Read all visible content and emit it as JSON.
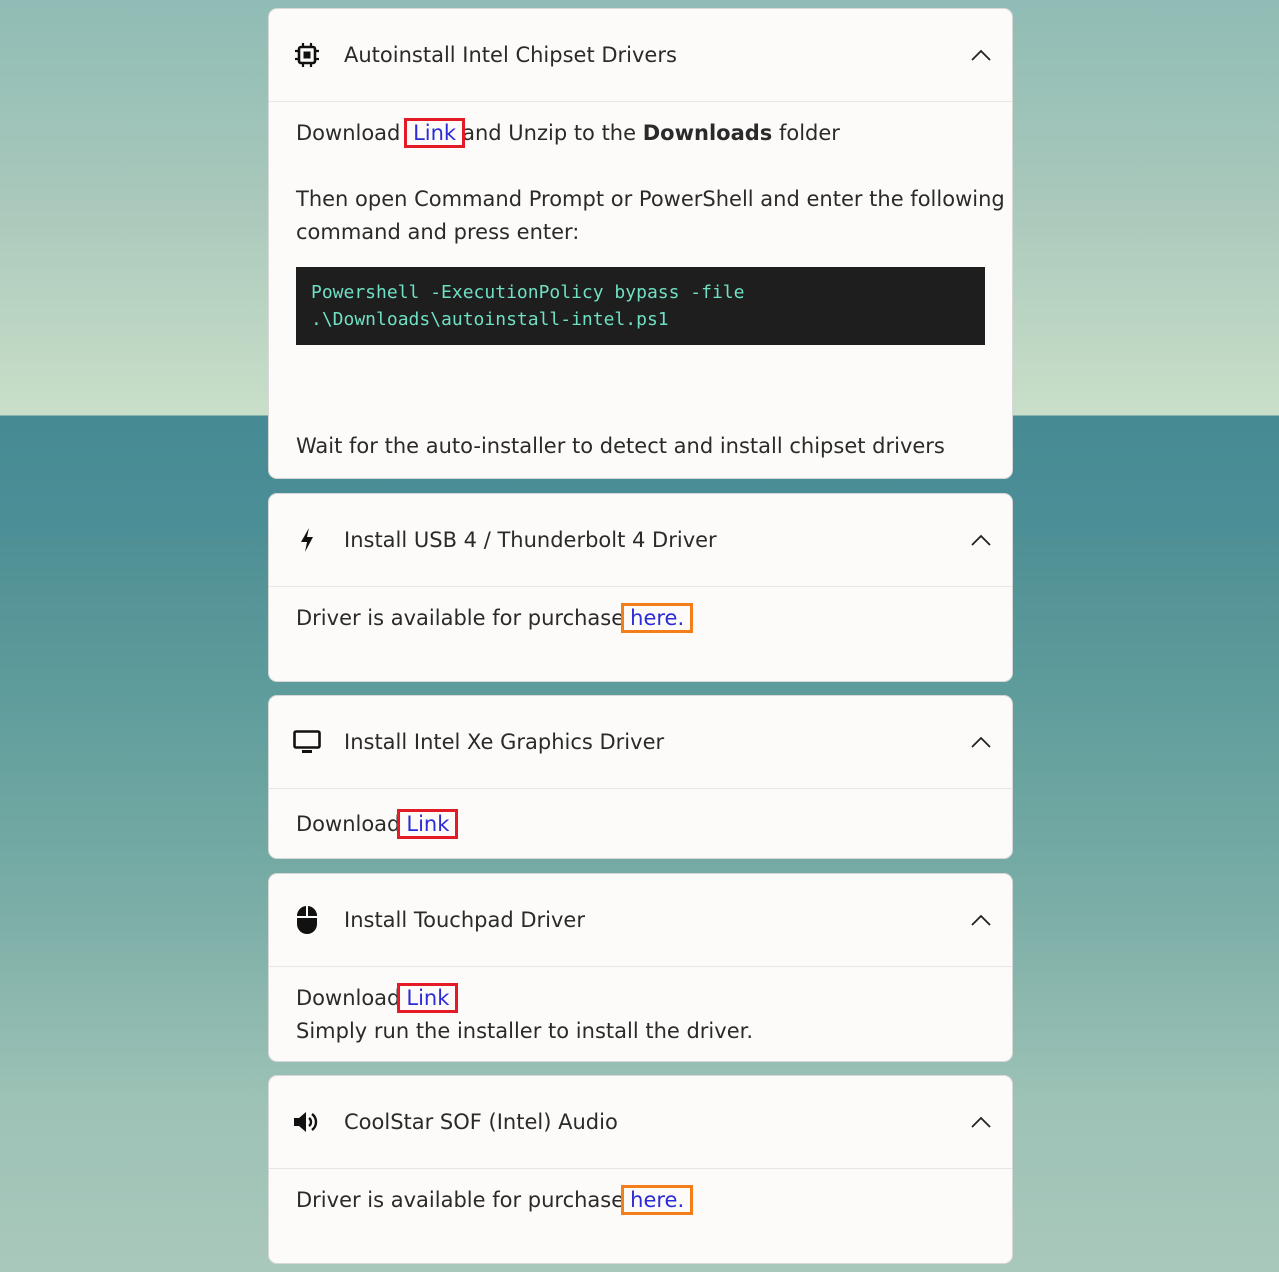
{
  "cards": [
    {
      "icon": "chip-icon",
      "title": "Autoinstall Intel Chipset Drivers",
      "download_prefix": "Download",
      "link_label": "Link",
      "unzip_text_a": "and Unzip to the",
      "unzip_bold": "Downloads",
      "unzip_text_b": "folder",
      "instruction_line1": "Then open Command Prompt or PowerShell and enter the following",
      "instruction_line2": "command and press enter:",
      "code_line1": "Powershell -ExecutionPolicy bypass -file",
      "code_line2": ".\\Downloads\\autoinstall-intel.ps1",
      "wait_text": "Wait for the auto-installer to detect and install chipset drivers"
    },
    {
      "icon": "lightning-icon",
      "title": "Install USB 4 / Thunderbolt 4 Driver",
      "purchase_prefix": "Driver is available for purchase",
      "link_label": "here."
    },
    {
      "icon": "monitor-icon",
      "title": "Install Intel Xe Graphics Driver",
      "download_prefix": "Download",
      "link_label": "Link"
    },
    {
      "icon": "mouse-icon",
      "title": "Install Touchpad Driver",
      "download_prefix": "Download",
      "link_label": "Link",
      "run_text": "Simply run the installer to install the driver."
    },
    {
      "icon": "speaker-icon",
      "title": "CoolStar SOF (Intel) Audio",
      "purchase_prefix": "Driver is available for purchase",
      "link_label": "here."
    }
  ],
  "colors": {
    "link": "#2b2bd8",
    "highlight_red": "#e21b26",
    "highlight_orange": "#f47f1a",
    "code_bg": "#1e1e1e",
    "code_text": "#6fe0c4"
  }
}
